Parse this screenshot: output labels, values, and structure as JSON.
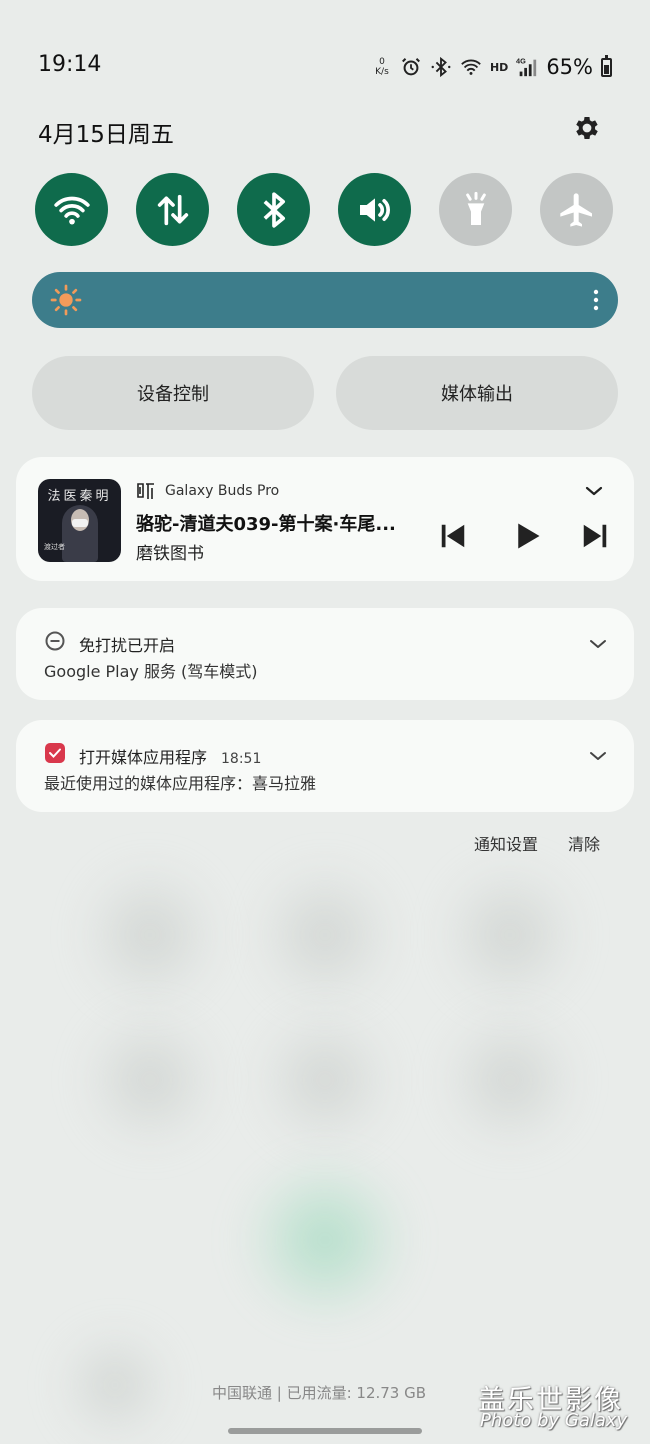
{
  "status_bar": {
    "time": "19:14",
    "net_speed_value": "0",
    "net_speed_unit": "K/s",
    "hd_label": "HD",
    "network_type": "4G",
    "battery_text": "65%",
    "icons": [
      "alarm-icon",
      "bluetooth-icon",
      "wifi-icon",
      "signal-icon",
      "battery-icon"
    ]
  },
  "header": {
    "date": "4月15日周五",
    "settings_icon": "gear-icon"
  },
  "quick_toggles": [
    {
      "name": "wifi",
      "state": "on",
      "icon": "wifi-icon"
    },
    {
      "name": "mobile-data",
      "state": "on",
      "icon": "data-arrows-icon"
    },
    {
      "name": "bluetooth",
      "state": "on",
      "icon": "bluetooth-icon"
    },
    {
      "name": "sound",
      "state": "on",
      "icon": "speaker-icon"
    },
    {
      "name": "flashlight",
      "state": "off",
      "icon": "flashlight-icon"
    },
    {
      "name": "airplane-mode",
      "state": "off",
      "icon": "airplane-icon"
    }
  ],
  "colors": {
    "toggle_on": "#0f6b4c",
    "toggle_off": "#c3c6c5",
    "brightness_bar": "#3d7d8b",
    "sun": "#f29b5a"
  },
  "panel_buttons": {
    "device_control": "设备控制",
    "media_output": "媒体输出"
  },
  "media": {
    "album_cover_text": "法医秦明",
    "album_small_text": "渡过者",
    "device": "Galaxy Buds Pro",
    "title": "骆驼-清道夫039-第十案·车尾...",
    "artist": "磨铁图书"
  },
  "notifications": [
    {
      "title": "免打扰已开启",
      "time": "",
      "body": "Google Play 服务 (驾车模式)",
      "icon": "do-not-disturb-icon"
    },
    {
      "title": "打开媒体应用程序",
      "time": "18:51",
      "body": "最近使用过的媒体应用程序：喜马拉雅",
      "icon": "media-app-icon"
    }
  ],
  "notification_actions": {
    "settings": "通知设置",
    "clear": "清除"
  },
  "footer": {
    "carrier": "中国联通 | 已用流量: 12.73 GB",
    "watermark_cn": "盖乐世影像",
    "watermark_en": "Photo by Galaxy"
  }
}
